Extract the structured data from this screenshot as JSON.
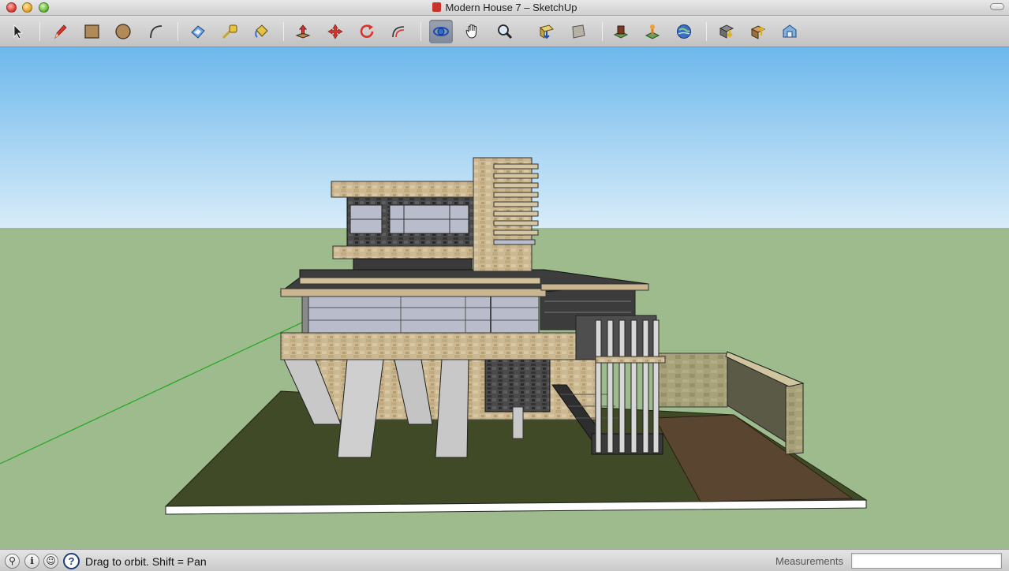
{
  "window": {
    "title": "Modern House 7 – SketchUp"
  },
  "toolbar": {
    "tools": [
      {
        "name": "select-icon",
        "label": "Select"
      },
      {
        "name": "pencil-icon",
        "label": "Line"
      },
      {
        "name": "rectangle-icon",
        "label": "Rectangle"
      },
      {
        "name": "circle-icon",
        "label": "Circle"
      },
      {
        "name": "arc-icon",
        "label": "Arc"
      },
      {
        "name": "eraser-icon",
        "label": "Eraser"
      },
      {
        "name": "tape-measure-icon",
        "label": "Tape Measure"
      },
      {
        "name": "paint-bucket-icon",
        "label": "Paint Bucket"
      },
      {
        "name": "push-pull-icon",
        "label": "Push/Pull"
      },
      {
        "name": "move-icon",
        "label": "Move"
      },
      {
        "name": "rotate-icon",
        "label": "Rotate"
      },
      {
        "name": "offset-icon",
        "label": "Offset"
      },
      {
        "name": "orbit-icon",
        "label": "Orbit",
        "active": true
      },
      {
        "name": "pan-hand-icon",
        "label": "Pan"
      },
      {
        "name": "zoom-icon",
        "label": "Zoom"
      },
      {
        "name": "zoom-extents-icon",
        "label": "Zoom Extents"
      },
      {
        "name": "previous-view-icon",
        "label": "Previous"
      },
      {
        "name": "get-models-icon",
        "label": "Get Models"
      },
      {
        "name": "add-location-icon",
        "label": "Add Location"
      },
      {
        "name": "google-earth-icon",
        "label": "Google Earth"
      },
      {
        "name": "share-model-icon",
        "label": "Share Model"
      },
      {
        "name": "share-component-icon",
        "label": "Share Component"
      },
      {
        "name": "warehouse-icon",
        "label": "3D Warehouse"
      }
    ]
  },
  "colors": {
    "sky_top": "#6db8ec",
    "sky_bottom": "#d8ecf8",
    "ground": "#9dbb8d",
    "site_pad": "#404a26",
    "driveway": "#5a4530",
    "stone": "#c9b58f",
    "dark_stone": "#4a4a4a",
    "glass": "#b9bccb",
    "axis_green": "#1fa81f"
  },
  "status": {
    "hint": "Drag to orbit.  Shift = Pan",
    "measurements_label": "Measurements",
    "measurements_value": ""
  }
}
